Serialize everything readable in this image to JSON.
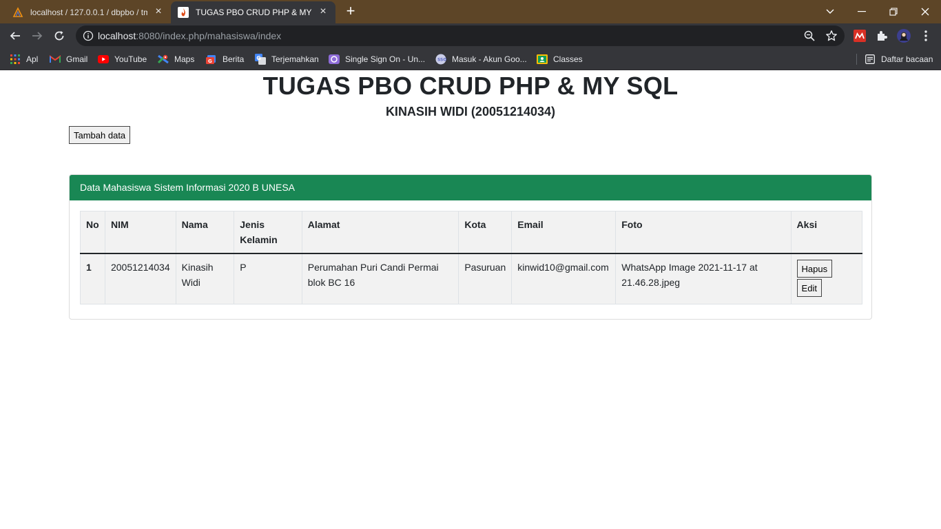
{
  "browser": {
    "tabs": [
      {
        "title": "localhost / 127.0.0.1 / dbpbo / tm",
        "active": false
      },
      {
        "title": "TUGAS PBO CRUD PHP & MY SQL",
        "active": true
      }
    ],
    "url": {
      "host": "localhost",
      "rest": ":8080/index.php/mahasiswa/index"
    },
    "bookmarks": [
      {
        "label": "Apl",
        "icon": "apps-grid-icon"
      },
      {
        "label": "Gmail",
        "icon": "gmail-icon"
      },
      {
        "label": "YouTube",
        "icon": "youtube-icon"
      },
      {
        "label": "Maps",
        "icon": "maps-icon"
      },
      {
        "label": "Berita",
        "icon": "news-icon"
      },
      {
        "label": "Terjemahkan",
        "icon": "translate-icon"
      },
      {
        "label": "Single Sign On - Un...",
        "icon": "sso-icon"
      },
      {
        "label": "Masuk - Akun Goo...",
        "icon": "google-account-icon"
      },
      {
        "label": "Classes",
        "icon": "classroom-icon"
      }
    ],
    "reading_list": "Daftar bacaan"
  },
  "page": {
    "title": "TUGAS PBO CRUD PHP & MY SQL",
    "subtitle": "KINASIH WIDI (20051214034)",
    "add_button": "Tambah data",
    "card_title": "Data Mahasiswa Sistem Informasi 2020 B UNESA",
    "table": {
      "headers": [
        "No",
        "NIM",
        "Nama",
        "Jenis Kelamin",
        "Alamat",
        "Kota",
        "Email",
        "Foto",
        "Aksi"
      ],
      "rows": [
        {
          "no": "1",
          "nim": "20051214034",
          "nama": "Kinasih Widi",
          "jenis_kelamin": "P",
          "alamat": "Perumahan Puri Candi Permai blok BC 16",
          "kota": "Pasuruan",
          "email": "kinwid10@gmail.com",
          "foto": "WhatsApp Image 2021-11-17 at 21.46.28.jpeg",
          "hapus": "Hapus",
          "edit": "Edit"
        }
      ]
    },
    "header_color": "#198754"
  }
}
